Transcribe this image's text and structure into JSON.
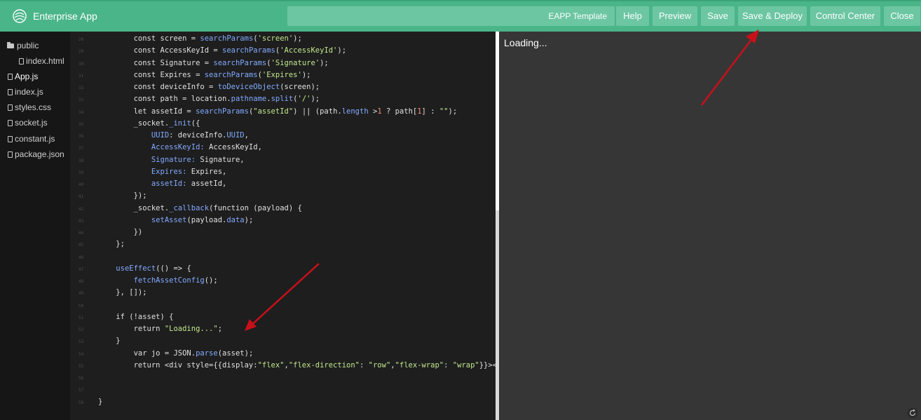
{
  "header": {
    "app_title": "Enterprise App",
    "template_label": "EAPP Template",
    "buttons": {
      "help": "Help",
      "preview": "Preview",
      "save": "Save",
      "save_deploy": "Save & Deploy",
      "control_center": "Control Center",
      "close": "Close"
    }
  },
  "sidebar": {
    "items": [
      {
        "label": "public",
        "type": "folder"
      },
      {
        "label": "index.html",
        "type": "file"
      },
      {
        "label": "App.js",
        "type": "file"
      },
      {
        "label": "index.js",
        "type": "file"
      },
      {
        "label": "styles.css",
        "type": "file"
      },
      {
        "label": "socket.js",
        "type": "file"
      },
      {
        "label": "constant.js",
        "type": "file"
      },
      {
        "label": "package.json",
        "type": "file"
      }
    ]
  },
  "editor": {
    "line_numbers": [
      "28",
      "29",
      "30",
      "31",
      "32",
      "33",
      "34",
      "35",
      "36",
      "37",
      "38",
      "39",
      "40",
      "41",
      "42",
      "43",
      "44",
      "45",
      "46",
      "47",
      "48",
      "49",
      "50",
      "51",
      "52",
      "53",
      "54",
      "55",
      "56",
      "57",
      "58"
    ],
    "lines": [
      "        const screen = searchParams('screen');",
      "        const AccessKeyId = searchParams('AccessKeyId');",
      "        const Signature = searchParams('Signature');",
      "        const Expires = searchParams('Expires');",
      "        const deviceInfo = toDeviceObject(screen);",
      "        const path = location.pathname.split('/');",
      "        let assetId = searchParams(\"assetId\") || (path.length >1 ? path[1] : \"\");",
      "        _socket._init({",
      "            UUID: deviceInfo.UUID,",
      "            AccessKeyId: AccessKeyId,",
      "            Signature: Signature,",
      "            Expires: Expires,",
      "            assetId: assetId,",
      "        });",
      "        _socket._callback(function (payload) {",
      "            setAsset(payload.data);",
      "        })",
      "    };",
      "",
      "    useEffect(() => {",
      "        fetchAssetConfig();",
      "    }, []);",
      "",
      "    if (!asset) {",
      "        return \"Loading...\";",
      "    }",
      "        var jo = JSON.parse(asset);",
      "        return <div style={{display:\"flex\",\"flex-direction\": \"row\",\"flex-wrap\": \"wrap\"}}><di",
      "",
      "",
      "}"
    ]
  },
  "preview": {
    "loading_text": "Loading..."
  },
  "colors": {
    "header_bg": "#4bb58a",
    "button_bg": "#6cc6a2",
    "annotation_arrow": "#c8101a"
  }
}
